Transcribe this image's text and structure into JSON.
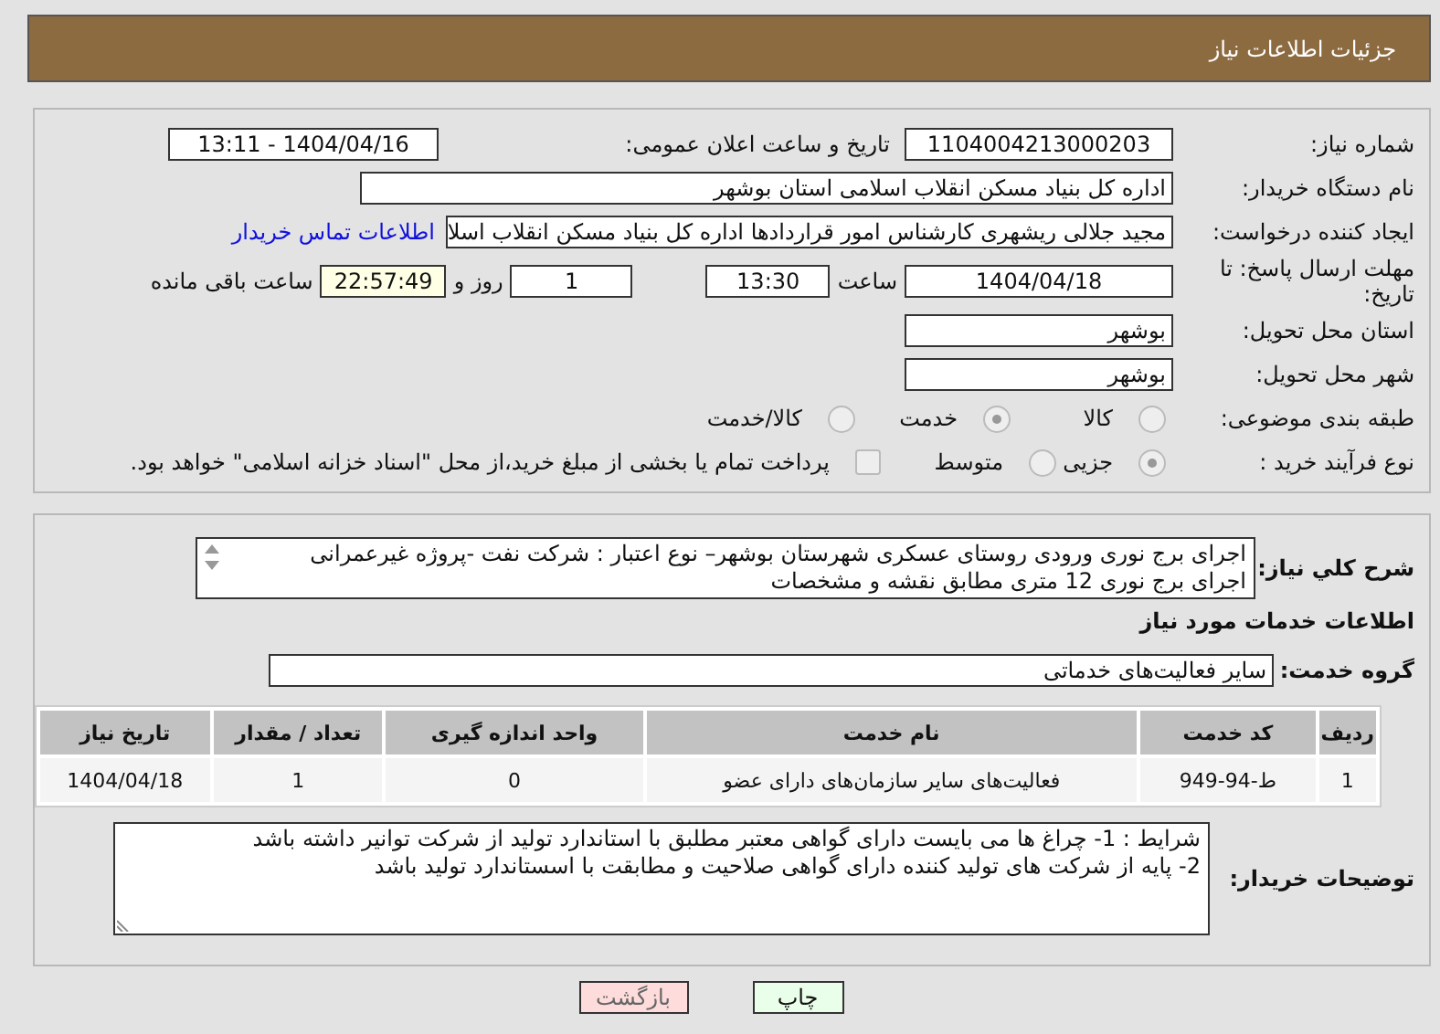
{
  "header": {
    "title": "جزئیات اطلاعات نیاز"
  },
  "details": {
    "need_number": {
      "label": "شماره نیاز:",
      "value": "1104004213000203"
    },
    "announce": {
      "label": "تاریخ و ساعت اعلان عمومی:",
      "value": "1404/04/16 - 13:11"
    },
    "buyer_org": {
      "label": "نام دستگاه خریدار:",
      "value": "اداره کل بنیاد مسکن انقلاب اسلامی استان بوشهر"
    },
    "requester": {
      "label": "ایجاد کننده درخواست:",
      "value": "مجید جلالی ریشهری کارشناس امور قراردادها اداره کل بنیاد مسکن انقلاب اسلا",
      "link": "اطلاعات تماس خریدار"
    },
    "deadline": {
      "label": "مهلت ارسال پاسخ: تا تاریخ:",
      "date": "1404/04/18",
      "time_label": "ساعت",
      "time": "13:30",
      "days": "1",
      "days_label": "روز و",
      "remaining": "22:57:49",
      "remaining_label": "ساعت باقی مانده"
    },
    "province": {
      "label": "استان محل تحویل:",
      "value": "بوشهر"
    },
    "city": {
      "label": "شهر محل تحویل:",
      "value": "بوشهر"
    },
    "category": {
      "label": "طبقه بندی موضوعی:",
      "options": [
        {
          "label": "کالا",
          "selected": false
        },
        {
          "label": "خدمت",
          "selected": true
        },
        {
          "label": "کالا/خدمت",
          "selected": false
        }
      ]
    },
    "purchase_type": {
      "label": "نوع فرآیند خرید :",
      "options": [
        {
          "label": "جزیی",
          "selected": true
        },
        {
          "label": "متوسط",
          "selected": false
        }
      ],
      "payment": {
        "label": "پرداخت تمام یا بخشی از مبلغ خرید،از محل \"اسناد خزانه اسلامی\" خواهد بود.",
        "checked": false
      }
    }
  },
  "services": {
    "description": {
      "label": "شرح كلي نياز:",
      "lines": [
        "اجرای برج نوری ورودی روستای عسکری شهرستان بوشهر– نوع اعتبار : شرکت نفت -پروژه غیرعمرانی",
        "اجرای برج نوری 12 متری مطابق نقشه و مشخصات"
      ]
    },
    "section_title": "اطلاعات خدمات مورد نیاز",
    "group": {
      "label": "گروه خدمت:",
      "value": "سایر فعالیت‌های خدماتی"
    },
    "table": {
      "columns": [
        "ردیف",
        "کد خدمت",
        "نام خدمت",
        "واحد اندازه گیری",
        "تعداد / مقدار",
        "تاریخ نیاز"
      ],
      "rows": [
        [
          "1",
          "ط-94-949",
          "فعالیت‌های سایر سازمان‌های دارای عضو",
          "0",
          "1",
          "1404/04/18"
        ]
      ]
    },
    "buyer_notes": {
      "label": "توضیحات خریدار:",
      "lines": [
        "شرایط : 1- چراغ ها می بایست دارای گواهی معتبر مطلبق با استاندارد تولید از شرکت توانیر داشته باشد",
        "2- پایه  از شرکت های تولید کننده دارای گواهی صلاحیت و مطابقت با اسستاندارد تولید باشد"
      ]
    }
  },
  "buttons": [
    {
      "label": "چاپ",
      "kind": "print"
    },
    {
      "label": "بازگشت",
      "kind": "back"
    }
  ]
}
